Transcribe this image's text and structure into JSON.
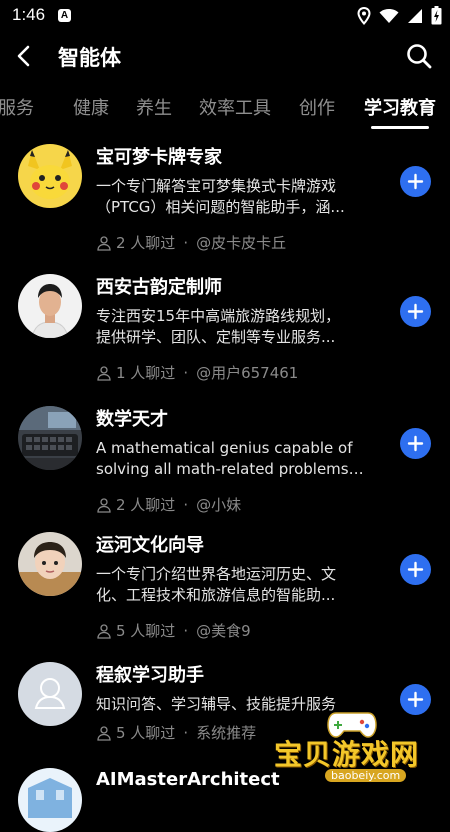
{
  "status": {
    "time": "1:46",
    "notif_icon": "a-icon",
    "a_glyph": "A"
  },
  "header": {
    "title": "智能体"
  },
  "tabs": [
    {
      "label": "服务",
      "active": false
    },
    {
      "label": "健康",
      "active": false
    },
    {
      "label": "养生",
      "active": false
    },
    {
      "label": "效率工具",
      "active": false
    },
    {
      "label": "创作",
      "active": false
    },
    {
      "label": "学习教育",
      "active": true
    }
  ],
  "agents": [
    {
      "name": "宝可梦卡牌专家",
      "desc1": "一个专门解答宝可梦集换式卡牌游戏",
      "desc2": "（PTCG）相关问题的智能助手，涵...",
      "chatted": "2 人聊过",
      "author": "@皮卡皮卡丘",
      "avatar": "pikachu-avatar"
    },
    {
      "name": "西安古韵定制师",
      "desc1": "专注西安15年中高端旅游路线规划，",
      "desc2": "提供研学、团队、定制等专业服务...",
      "chatted": "1 人聊过",
      "author": "@用户657461",
      "avatar": "man-portrait-avatar"
    },
    {
      "name": "数学天才",
      "desc1": "A mathematical genius capable of",
      "desc2": "solving all math-related problems, f...",
      "chatted": "2 人聊过",
      "author": "@小妹",
      "avatar": "keyboard-photo-avatar"
    },
    {
      "name": "运河文化向导",
      "desc1": "一个专门介绍世界各地运河历史、文",
      "desc2": "化、工程技术和旅游信息的智能助...",
      "chatted": "5 人聊过",
      "author": "@美食9",
      "avatar": "child-photo-avatar"
    },
    {
      "name": "程叙学习助手",
      "desc1": "知识问答、学习辅导、技能提升服务",
      "desc2": "",
      "chatted": "5 人聊过",
      "author": "系统推荐",
      "avatar": "default-user-avatar"
    },
    {
      "name": "AIMasterArchitect",
      "desc1": "",
      "desc2": "",
      "chatted": "",
      "author": "",
      "avatar": "architecture-avatar"
    }
  ],
  "meta_separator": "·",
  "watermark": {
    "text": "宝贝游戏网",
    "url": "baobeiy.com"
  },
  "colors": {
    "background": "#000000",
    "accent": "#2e6ff0",
    "muted": "#8a8a8a"
  }
}
